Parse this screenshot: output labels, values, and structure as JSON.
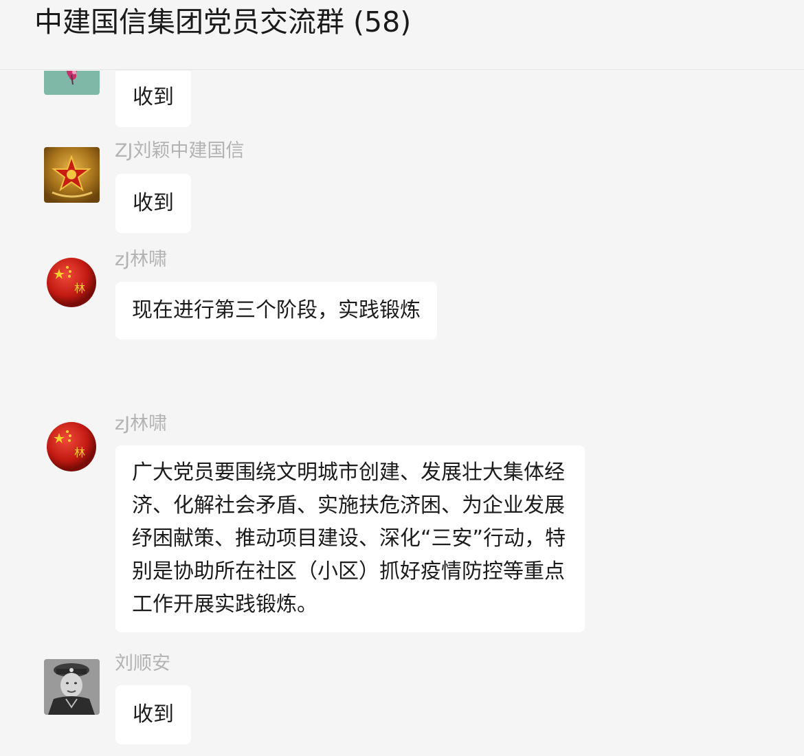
{
  "chat": {
    "title": "中建国信集团党员交流群 (58)"
  },
  "messages": [
    {
      "sender": "",
      "avatar": "pink-flower-avatar-icon",
      "text": "收到"
    },
    {
      "sender": "ZJ刘颖中建国信",
      "avatar": "red-star-emblem-avatar-icon",
      "text": "收到"
    },
    {
      "sender": "zJ林啸",
      "avatar": "red-ball-flag-avatar-icon",
      "text": "现在进行第三个阶段，实践锻炼"
    },
    {
      "sender": "zJ林啸",
      "avatar": "red-ball-flag-avatar-icon",
      "text": "广大党员要围绕文明城市创建、发展壮大集体经济、化解社会矛盾、实施扶危济困、为企业发展纾困献策、推动项目建设、深化“三安”行动，特别是协助所在社区（小区）抓好疫情防控等重点工作开展实践锻炼。"
    },
    {
      "sender": "刘顺安",
      "avatar": "soldier-portrait-avatar-icon",
      "text": "收到"
    }
  ]
}
